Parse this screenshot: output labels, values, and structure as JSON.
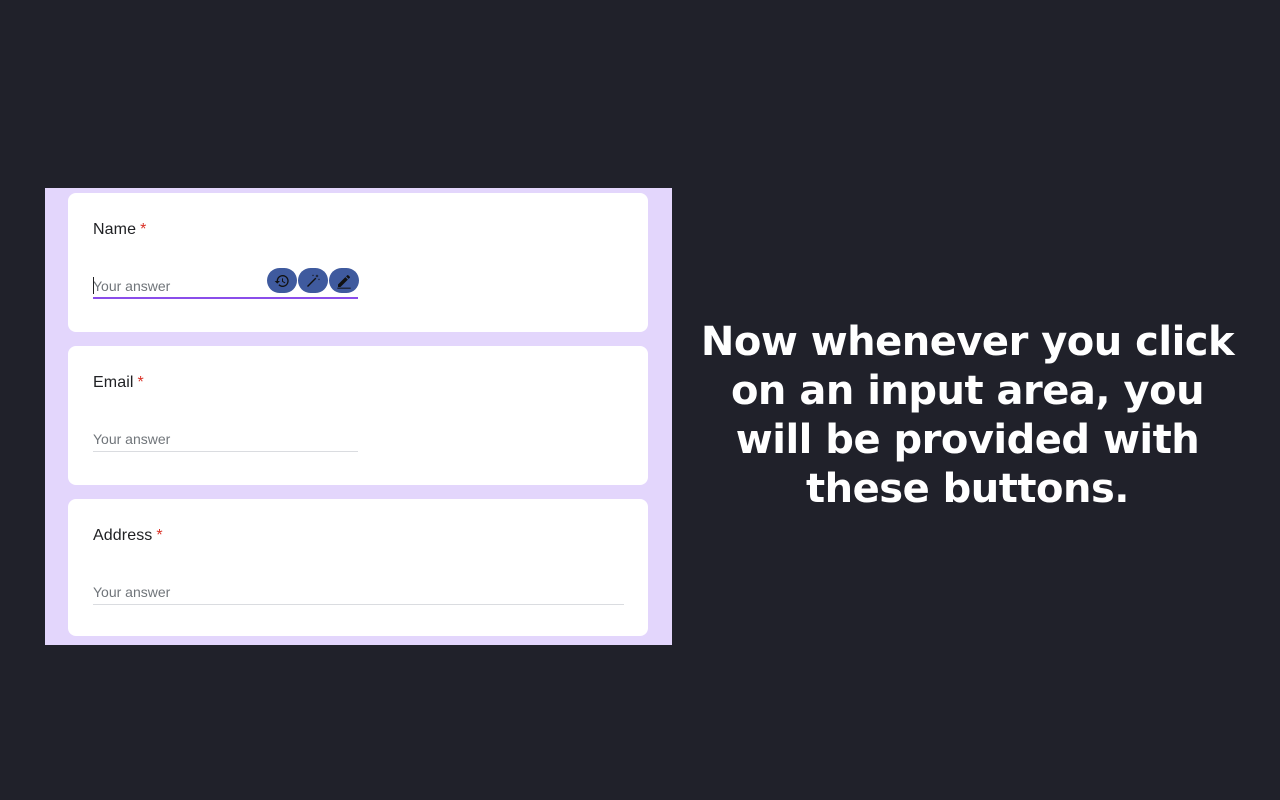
{
  "form": {
    "questions": [
      {
        "label": "Name",
        "required_mark": "*",
        "placeholder": "Your answer"
      },
      {
        "label": "Email",
        "required_mark": "*",
        "placeholder": "Your answer"
      },
      {
        "label": "Address",
        "required_mark": "*",
        "placeholder": "Your answer"
      }
    ],
    "toolbar": {
      "buttons": [
        {
          "icon": "history-icon"
        },
        {
          "icon": "magic-wand-icon"
        },
        {
          "icon": "pencil-icon"
        }
      ]
    }
  },
  "caption": {
    "text": "Now whenever you click on an input area, you will be provided with these buttons."
  },
  "colors": {
    "page_background": "#20212a",
    "form_background": "#e3d6fc",
    "card_background": "#ffffff",
    "focus_underline": "#8a4dea",
    "required": "#d93025",
    "tool_button": "#3f5a9e"
  }
}
